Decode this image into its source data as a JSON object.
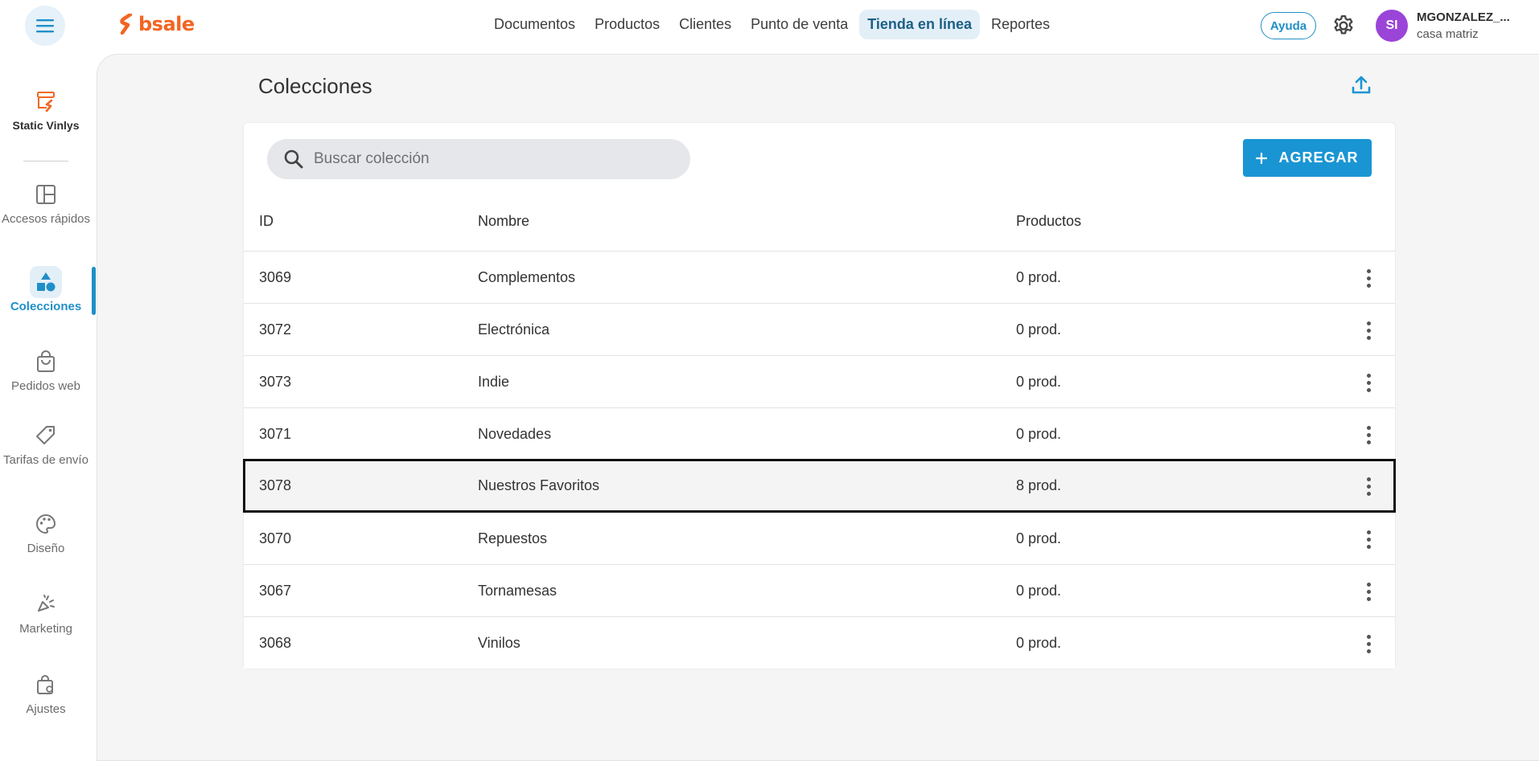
{
  "header": {
    "logo_text": "bsale",
    "nav": [
      {
        "label": "Documentos",
        "active": false
      },
      {
        "label": "Productos",
        "active": false
      },
      {
        "label": "Clientes",
        "active": false
      },
      {
        "label": "Punto de venta",
        "active": false
      },
      {
        "label": "Tienda en línea",
        "active": true
      },
      {
        "label": "Reportes",
        "active": false
      }
    ],
    "help_label": "Ayuda",
    "user": {
      "initials": "SI",
      "name": "MGONZALEZ_...",
      "branch": "casa matriz"
    }
  },
  "sidebar": {
    "store": {
      "label": "Static Vinlys",
      "icon": "store-icon"
    },
    "items": [
      {
        "label": "Accesos rápidos",
        "icon": "dashboard-icon",
        "active": false
      },
      {
        "label": "Colecciones",
        "icon": "shapes-icon",
        "active": true
      },
      {
        "label": "Pedidos web",
        "icon": "shopping-bag-icon",
        "active": false
      },
      {
        "label": "Tarifas de envío",
        "icon": "tag-icon",
        "active": false
      },
      {
        "label": "Diseño",
        "icon": "palette-icon",
        "active": false
      },
      {
        "label": "Marketing",
        "icon": "megaphone-icon",
        "active": false
      },
      {
        "label": "Ajustes",
        "icon": "bag-settings-icon",
        "active": false
      }
    ]
  },
  "page": {
    "title": "Colecciones",
    "search_placeholder": "Buscar colección",
    "add_label": "AGREGAR",
    "columns": {
      "id": "ID",
      "name": "Nombre",
      "products": "Productos"
    },
    "rows": [
      {
        "id": "3069",
        "name": "Complementos",
        "products": "0 prod."
      },
      {
        "id": "3072",
        "name": "Electrónica",
        "products": "0 prod."
      },
      {
        "id": "3073",
        "name": "Indie",
        "products": "0 prod."
      },
      {
        "id": "3071",
        "name": "Novedades",
        "products": "0 prod."
      },
      {
        "id": "3078",
        "name": "Nuestros Favoritos",
        "products": "8 prod."
      },
      {
        "id": "3070",
        "name": "Repuestos",
        "products": "0 prod."
      },
      {
        "id": "3067",
        "name": "Tornamesas",
        "products": "0 prod."
      },
      {
        "id": "3068",
        "name": "Vinilos",
        "products": "0 prod."
      }
    ],
    "highlighted_row": 4
  },
  "colors": {
    "accent": "#1a95d3",
    "brand": "#f26522",
    "avatar": "#9b44d8"
  }
}
